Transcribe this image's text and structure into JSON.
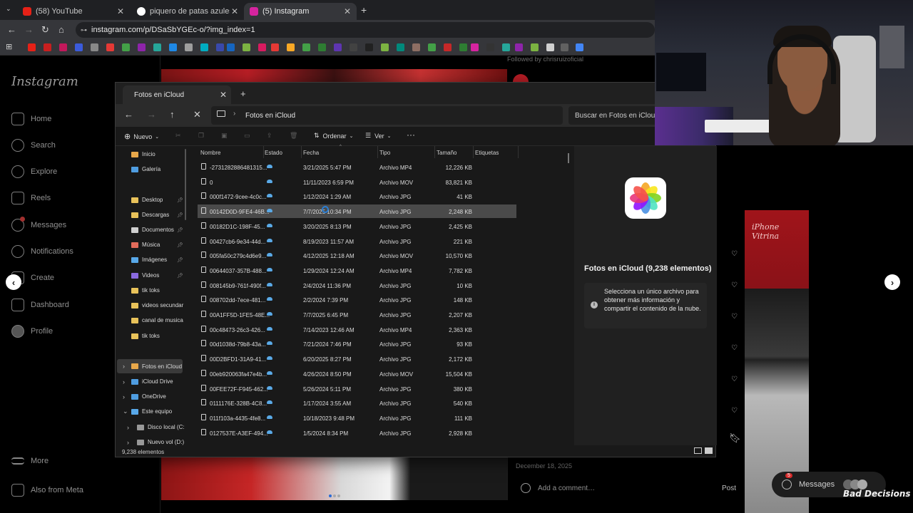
{
  "browser": {
    "tabs": [
      {
        "title": "(58) YouTube",
        "color": "#e62117"
      },
      {
        "title": "piquero de patas azules - Busca",
        "color": "#4285f4"
      },
      {
        "title": "(5) Instagram",
        "color": "#d6249f"
      }
    ],
    "url": "instagram.com/p/DSaSbYGEc-o/?img_index=1"
  },
  "instagram": {
    "logo": "Instagram",
    "nav": [
      "Home",
      "Search",
      "Explore",
      "Reels",
      "Messages",
      "Notifications",
      "Create",
      "Dashboard",
      "Profile"
    ],
    "more": "More",
    "also_from_meta": "Also from Meta",
    "followed_by": "Followed by chrisruizoficial",
    "posted_date": "December 18, 2025",
    "comment_placeholder": "Add a comment…",
    "post_button": "Post",
    "grid_label": "iPhone\nVitrina",
    "messages_pill": "Messages",
    "messages_badge": "5"
  },
  "explorer": {
    "tab_title": "Fotos en iCloud",
    "breadcrumb": "Fotos en iCloud",
    "search_placeholder": "Buscar en Fotos en iCloud",
    "toolbar": {
      "new": "Nuevo",
      "sort": "Ordenar",
      "view": "Ver"
    },
    "columns": [
      "Nombre",
      "Estado",
      "Fecha",
      "Tipo",
      "Tamaño",
      "Etiquetas"
    ],
    "nav_items": [
      {
        "label": "Inicio",
        "color": "#e8a84a"
      },
      {
        "label": "Galería",
        "color": "#4f9de0"
      },
      {
        "label": "Desktop",
        "color": "#e8c25a"
      },
      {
        "label": "Descargas",
        "color": "#e8c25a"
      },
      {
        "label": "Documentos",
        "color": "#cfcfcf"
      },
      {
        "label": "Música",
        "color": "#e26b5a"
      },
      {
        "label": "Imágenes",
        "color": "#58a8e8"
      },
      {
        "label": "Videos",
        "color": "#8a6ae0"
      },
      {
        "label": "tik toks",
        "color": "#e8c25a"
      },
      {
        "label": "videos secundar",
        "color": "#e8c25a"
      },
      {
        "label": "canal de musica",
        "color": "#e8c25a"
      },
      {
        "label": "tik toks",
        "color": "#e8c25a"
      }
    ],
    "tree_items": [
      "Fotos en iCloud",
      "iCloud Drive",
      "OneDrive",
      "Este equipo",
      "Disco local (C:",
      "Nuevo vol (D:)"
    ],
    "files": [
      {
        "name": "-2731282886481315...",
        "date": "3/21/2025 5:47 PM",
        "type": "Archivo MP4",
        "size": "12,226 KB"
      },
      {
        "name": "0",
        "date": "11/11/2023 6:59 PM",
        "type": "Archivo MOV",
        "size": "83,821 KB"
      },
      {
        "name": "000f1472-9cee-4c0c...",
        "date": "1/12/2024 1:29 AM",
        "type": "Archivo JPG",
        "size": "41 KB"
      },
      {
        "name": "00142D0D-9FE4-46B...",
        "date": "7/7/2025 10:34 PM",
        "type": "Archivo JPG",
        "size": "2,248 KB"
      },
      {
        "name": "00182D1C-198F-45...",
        "date": "3/20/2025 8:13 PM",
        "type": "Archivo JPG",
        "size": "2,425 KB"
      },
      {
        "name": "00427cb6-9e34-44d...",
        "date": "8/19/2023 11:57 AM",
        "type": "Archivo JPG",
        "size": "221 KB"
      },
      {
        "name": "005fa50c279c4d6e9...",
        "date": "4/12/2025 12:18 AM",
        "type": "Archivo MOV",
        "size": "10,570 KB"
      },
      {
        "name": "00644037-357B-488...",
        "date": "1/29/2024 12:24 AM",
        "type": "Archivo MP4",
        "size": "7,782 KB"
      },
      {
        "name": "008145b9-761f-490f...",
        "date": "2/4/2024 11:36 PM",
        "type": "Archivo JPG",
        "size": "10 KB"
      },
      {
        "name": "008702dd-7ece-481...",
        "date": "2/2/2024 7:39 PM",
        "type": "Archivo JPG",
        "size": "148 KB"
      },
      {
        "name": "00A1FF5D-1FE5-48E...",
        "date": "7/7/2025 6:45 PM",
        "type": "Archivo JPG",
        "size": "2,207 KB"
      },
      {
        "name": "00c48473-26c3-426...",
        "date": "7/14/2023 12:46 AM",
        "type": "Archivo MP4",
        "size": "2,363 KB"
      },
      {
        "name": "00d1038d-79b8-43a...",
        "date": "7/21/2024 7:46 PM",
        "type": "Archivo JPG",
        "size": "93 KB"
      },
      {
        "name": "00D2BFD1-31A9-41...",
        "date": "6/20/2025 8:27 PM",
        "type": "Archivo JPG",
        "size": "2,172 KB"
      },
      {
        "name": "00eb920063fa47e4b...",
        "date": "4/26/2024 8:50 PM",
        "type": "Archivo MOV",
        "size": "15,504 KB"
      },
      {
        "name": "00FEE72F-F945-462...",
        "date": "5/26/2024 5:11 PM",
        "type": "Archivo JPG",
        "size": "380 KB"
      },
      {
        "name": "0111176E-328B-4C8...",
        "date": "1/17/2024 3:55 AM",
        "type": "Archivo JPG",
        "size": "540 KB"
      },
      {
        "name": "011f103a-4435-4fe8...",
        "date": "10/18/2023 9:48 PM",
        "type": "Archivo JPG",
        "size": "111 KB"
      },
      {
        "name": "0127537E-A3EF-494...",
        "date": "1/5/2024 8:34 PM",
        "type": "Archivo JPG",
        "size": "2,928 KB"
      }
    ],
    "selected_index": 3,
    "preview_title": "Fotos en iCloud (9,238 elementos)",
    "preview_info": "Selecciona un único archivo para obtener más información y compartir el contenido de la nube.",
    "status": "9,238 elementos"
  },
  "watermark": "Bad Decisions"
}
